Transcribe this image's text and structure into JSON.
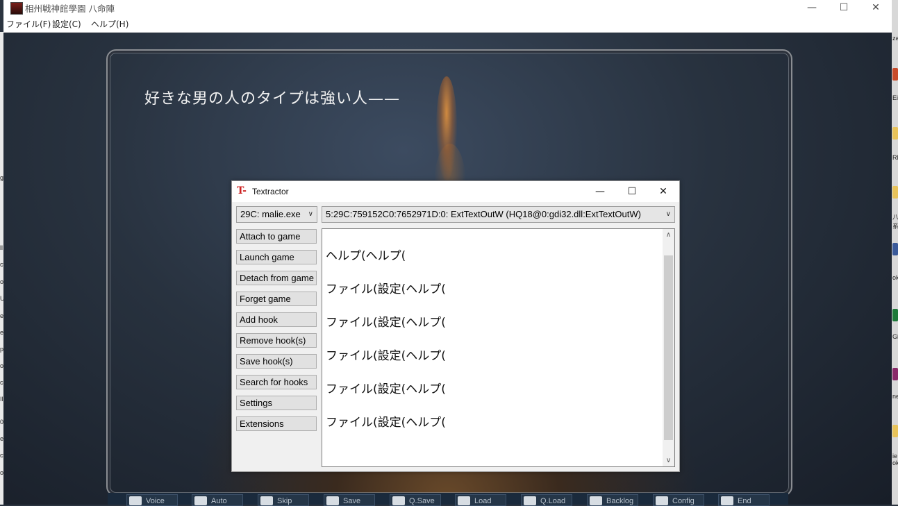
{
  "game_window": {
    "title": "相州戦神館學園 八命陣",
    "controls": {
      "minimize": "—",
      "maximize": "☐",
      "close": "✕"
    },
    "menu": [
      {
        "label": "ファイル(F)"
      },
      {
        "label": "設定(C)"
      },
      {
        "label": "ヘルプ(H)"
      }
    ],
    "dialogue_text": "好きな男の人のタイプは強い人——",
    "bottom_buttons": [
      {
        "label": "Voice"
      },
      {
        "label": "Auto"
      },
      {
        "label": "Skip"
      },
      {
        "label": "Save"
      },
      {
        "label": "Q.Save"
      },
      {
        "label": "Load"
      },
      {
        "label": "Q.Load"
      },
      {
        "label": "Backlog"
      },
      {
        "label": "Config"
      },
      {
        "label": "End"
      }
    ]
  },
  "textractor": {
    "title": "Textractor",
    "logo": {
      "t": "T",
      "dash": "-"
    },
    "controls": {
      "minimize": "—",
      "maximize": "☐",
      "close": "✕"
    },
    "process_select": "29C: malie.exe",
    "hook_select": "5:29C:759152C0:7652971D:0: ExtTextOutW (HQ18@0:gdi32.dll:ExtTextOutW)",
    "buttons": [
      {
        "label": "Attach to game"
      },
      {
        "label": "Launch game"
      },
      {
        "label": "Detach from game"
      },
      {
        "label": "Forget game"
      },
      {
        "label": "Add hook"
      },
      {
        "label": "Remove hook(s)"
      },
      {
        "label": "Save hook(s)"
      },
      {
        "label": "Search for hooks"
      },
      {
        "label": "Settings"
      },
      {
        "label": "Extensions"
      }
    ],
    "output_lines": [
      "ヘルプ(ヘルプ(",
      "ファイル(設定(ヘルプ(",
      "ファイル(設定(ヘルプ(",
      "ファイル(設定(ヘルプ(",
      "ファイル(設定(ヘルプ(",
      "ファイル(設定(ヘルプ("
    ]
  },
  "desktop_right_labels": [
    "za",
    "Ei",
    "RE",
    "八\n系",
    "ok",
    "Gi",
    "ne",
    "ie\nok"
  ],
  "desktop_left_labels": [
    "g",
    "ll",
    "ct",
    "ol",
    "U",
    "er",
    "el",
    "p",
    "ol",
    "ck",
    "Il",
    "0",
    "er",
    "ct",
    "ol"
  ]
}
